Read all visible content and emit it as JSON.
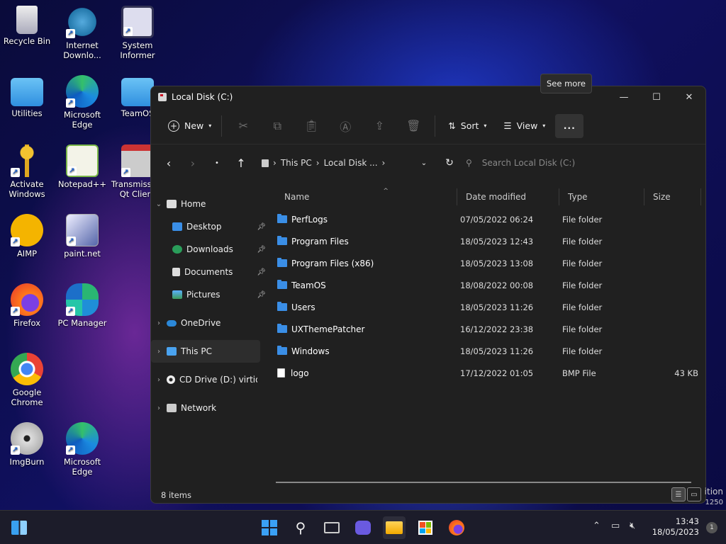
{
  "desktop": {
    "icons": [
      {
        "label": "Recycle Bin"
      },
      {
        "label": "Internet Downlo..."
      },
      {
        "label": "System Informer"
      },
      {
        "label": "Utilities"
      },
      {
        "label": "Microsoft Edge"
      },
      {
        "label": "TeamOS"
      },
      {
        "label": "Activate Windows"
      },
      {
        "label": "Notepad++"
      },
      {
        "label": "Transmission Qt Client"
      },
      {
        "label": "AIMP"
      },
      {
        "label": "paint.net"
      },
      {
        "label": "Firefox"
      },
      {
        "label": "PC Manager"
      },
      {
        "label": "Google Chrome"
      },
      {
        "label": "ImgBurn"
      },
      {
        "label": "Microsoft Edge"
      }
    ],
    "watermark_lines": [
      "ition",
      "1250"
    ]
  },
  "window": {
    "title": "Local Disk (C:)",
    "controls": {
      "minimize": "—",
      "maximize": "☐",
      "close": "✕"
    }
  },
  "toolbar": {
    "new_label": "New",
    "sort_label": "Sort",
    "view_label": "View",
    "see_more_label": "...",
    "tooltip": "See more"
  },
  "address": {
    "crumbs": [
      "This PC",
      "Local Disk ..."
    ],
    "search_placeholder": "Search Local Disk (C:)"
  },
  "sidebar": {
    "items": [
      {
        "label": "Home"
      },
      {
        "label": "Desktop"
      },
      {
        "label": "Downloads"
      },
      {
        "label": "Documents"
      },
      {
        "label": "Pictures"
      },
      {
        "label": "OneDrive"
      },
      {
        "label": "This PC"
      },
      {
        "label": "CD Drive (D:) virtio-v"
      },
      {
        "label": "Network"
      }
    ]
  },
  "columns": {
    "name": "Name",
    "date": "Date modified",
    "type": "Type",
    "size": "Size"
  },
  "files": [
    {
      "name": "PerfLogs",
      "date": "07/05/2022 06:24",
      "type": "File folder",
      "size": ""
    },
    {
      "name": "Program Files",
      "date": "18/05/2023 12:43",
      "type": "File folder",
      "size": ""
    },
    {
      "name": "Program Files (x86)",
      "date": "18/05/2023 13:08",
      "type": "File folder",
      "size": ""
    },
    {
      "name": "TeamOS",
      "date": "18/08/2022 00:08",
      "type": "File folder",
      "size": ""
    },
    {
      "name": "Users",
      "date": "18/05/2023 11:26",
      "type": "File folder",
      "size": ""
    },
    {
      "name": "UXThemePatcher",
      "date": "16/12/2022 23:38",
      "type": "File folder",
      "size": ""
    },
    {
      "name": "Windows",
      "date": "18/05/2023 11:26",
      "type": "File folder",
      "size": ""
    },
    {
      "name": "logo",
      "date": "17/12/2022 01:05",
      "type": "BMP File",
      "size": "43 KB"
    }
  ],
  "status": {
    "item_count": "8 items"
  },
  "taskbar": {
    "time": "13:43",
    "date": "18/05/2023",
    "notification_count": "1"
  }
}
